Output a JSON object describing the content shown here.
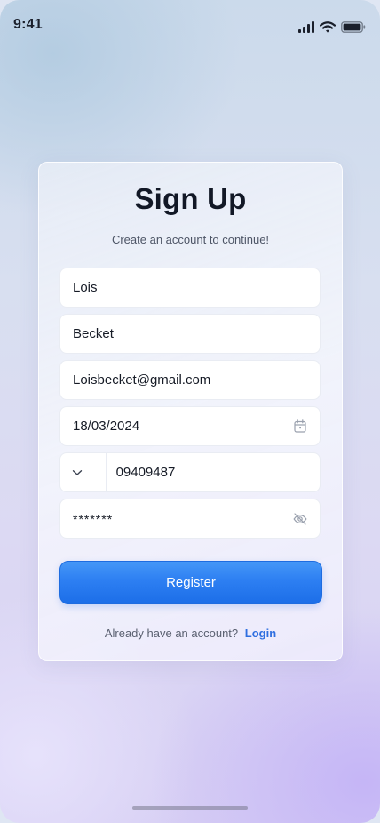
{
  "status_bar": {
    "time": "9:41"
  },
  "form": {
    "title": "Sign Up",
    "subtitle": "Create an account to continue!",
    "first_name": {
      "value": "Lois"
    },
    "last_name": {
      "value": "Becket"
    },
    "email": {
      "value": "Loisbecket@gmail.com"
    },
    "birth_date": {
      "value": "18/03/2024",
      "icon": "calendar-icon"
    },
    "phone": {
      "country_icon": "chevron-down-icon",
      "value": "09409487"
    },
    "password": {
      "value": "*******",
      "icon": "eye-off-icon"
    },
    "register_label": "Register",
    "login_prompt": "Already have an account?",
    "login_link": "Login"
  },
  "colors": {
    "accent": "#2d7ff2",
    "link": "#2f6fe0",
    "title": "#121826"
  }
}
